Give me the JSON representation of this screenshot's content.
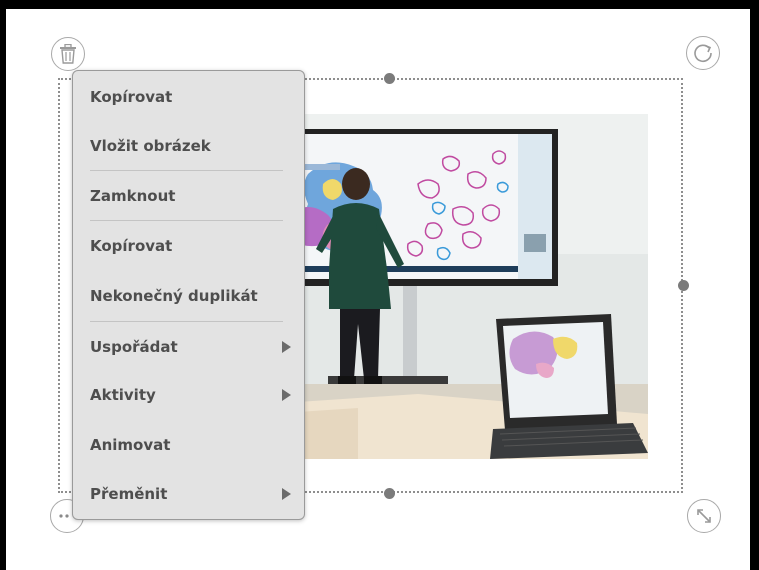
{
  "menu": {
    "items": [
      {
        "label": "Kopírovat",
        "submenu": false
      },
      {
        "label": "Vložit obrázek",
        "submenu": false
      },
      {
        "label": "Zamknout",
        "submenu": false
      },
      {
        "label": "Kopírovat",
        "submenu": false
      },
      {
        "label": "Nekonečný duplikát",
        "submenu": false
      },
      {
        "label": "Uspořádat",
        "submenu": true
      },
      {
        "label": "Aktivity",
        "submenu": true
      },
      {
        "label": "Animovat",
        "submenu": false
      },
      {
        "label": "Přeměnit",
        "submenu": true
      }
    ]
  },
  "icons": {
    "delete": "trash-icon",
    "rotate": "rotate-icon",
    "resize": "resize-diagonal-icon",
    "more": "more-dots-icon"
  },
  "colors": {
    "menu_background": "#e3e3e3",
    "menu_text": "#4e4e4e",
    "selection_border": "#8e8e8e",
    "handle": "#7b7b7b"
  }
}
